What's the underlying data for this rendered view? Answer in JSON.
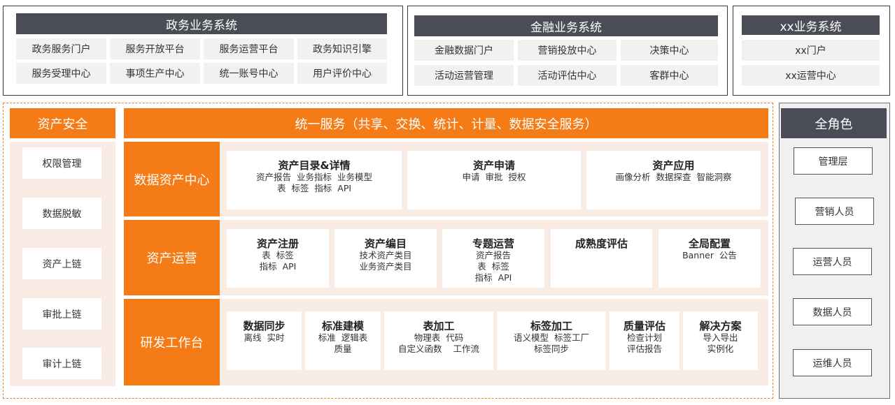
{
  "top_systems": [
    {
      "title": "政务业务系统",
      "items": [
        "政务服务门户",
        "服务开放平台",
        "服务运营平台",
        "政务知识引擎",
        "服务受理中心",
        "事项生产中心",
        "统一账号中心",
        "用户评价中心"
      ]
    },
    {
      "title": "金融业务系统",
      "items": [
        "金融数据门户",
        "营销投放中心",
        "决策中心",
        "活动运营管理",
        "活动评估中心",
        "客群中心"
      ]
    },
    {
      "title": "xx业务系统",
      "items": [
        "xx门户",
        "xx运营中心"
      ]
    }
  ],
  "asset_security": {
    "title": "资产安全",
    "items": [
      "权限管理",
      "数据脱敏",
      "资产上链",
      "审批上链",
      "审计上链"
    ]
  },
  "unified_service": {
    "title": "统一服务（共享、交换、统计、计量、数据安全服务）"
  },
  "rows": [
    {
      "label": "数据资产中心",
      "cards": [
        {
          "title": "资产目录&详情",
          "sub": "资产报告  业务指标  业务模型\n表  标签  指标  API"
        },
        {
          "title": "资产申请",
          "sub": "申请  审批  授权"
        },
        {
          "title": "资产应用",
          "sub": "画像分析  数据探查  智能洞察"
        }
      ]
    },
    {
      "label": "资产运营",
      "cards": [
        {
          "title": "资产注册",
          "sub": "表  标签\n指标  API"
        },
        {
          "title": "资产编目",
          "sub": "技术资产类目\n业务资产类目"
        },
        {
          "title": "专题运营",
          "sub": "资产报告\n表  标签\n指标  API"
        },
        {
          "title": "成熟度评估",
          "sub": ""
        },
        {
          "title": "全局配置",
          "sub": "Banner  公告"
        }
      ]
    },
    {
      "label": "研发工作台",
      "cards": [
        {
          "title": "数据同步",
          "sub": "离线  实时"
        },
        {
          "title": "标准建模",
          "sub": "标准  逻辑表\n质量"
        },
        {
          "title": "表加工",
          "sub": "物理表  代码\n自定义函数    工作流"
        },
        {
          "title": "标签加工",
          "sub": "语义模型  标签工厂\n标签同步"
        },
        {
          "title": "质量评估",
          "sub": "检查计划\n评估报告"
        },
        {
          "title": "解决方案",
          "sub": "导入导出\n实例化"
        }
      ]
    }
  ],
  "roles": {
    "title": "全角色",
    "items": [
      "管理层",
      "营销人员",
      "运营人员",
      "数据人员",
      "运维人员"
    ]
  }
}
